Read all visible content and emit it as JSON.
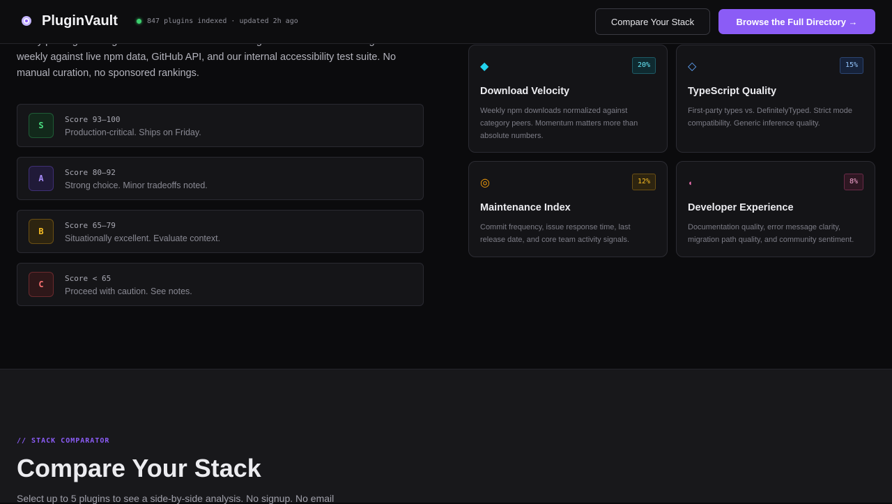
{
  "header": {
    "brand": "PluginVault",
    "status": "847 plugins indexed · updated 2h ago",
    "compare_label": "Compare Your Stack",
    "browse_label": "Browse the Full Directory →"
  },
  "intro": {
    "text": "Every package in PluginVault is scored across six weighted dimensions. The algorithm runs weekly against live npm data, GitHub API, and our internal accessibility test suite. No manual curation, no sponsored rankings."
  },
  "tiers": [
    {
      "grade": "S",
      "range": "Score 93–100",
      "desc": "Production-critical. Ships on Friday.",
      "color": "#4ade80"
    },
    {
      "grade": "A",
      "range": "Score 80–92",
      "desc": "Strong choice. Minor tradeoffs noted.",
      "color": "#a78bfa"
    },
    {
      "grade": "B",
      "range": "Score 65–79",
      "desc": "Situationally excellent. Evaluate context.",
      "color": "#fbbf24"
    },
    {
      "grade": "C",
      "range": "Score < 65",
      "desc": "Proceed with caution. See notes.",
      "color": "#f87171"
    }
  ],
  "dimensions": [
    {
      "icon": "◆",
      "icon_name": "diamond-filled-icon",
      "weight": "20%",
      "title": "Download Velocity",
      "desc": "Weekly npm downloads normalized against category peers. Momentum matters more than absolute numbers.",
      "color": "#22d3ee"
    },
    {
      "icon": "◇",
      "icon_name": "diamond-outline-icon",
      "weight": "15%",
      "title": "TypeScript Quality",
      "desc": "First-party types vs. DefinitelyTyped. Strict mode compatibility. Generic inference quality.",
      "color": "#60a5fa"
    },
    {
      "icon": "◎",
      "icon_name": "target-icon",
      "weight": "12%",
      "title": "Maintenance Index",
      "desc": "Commit frequency, issue response time, last release date, and core team activity signals.",
      "color": "#f59e0b"
    },
    {
      "icon": "◖",
      "icon_name": "half-circle-icon",
      "weight": "8%",
      "title": "Developer Experience",
      "desc": "Documentation quality, error message clarity, migration path quality, and community sentiment.",
      "color": "#f472b6"
    }
  ],
  "comparator": {
    "kicker": "// STACK COMPARATOR",
    "title": "Compare Your Stack",
    "subtitle": "Select up to 5 plugins to see a side-by-side analysis. No signup. No email"
  }
}
